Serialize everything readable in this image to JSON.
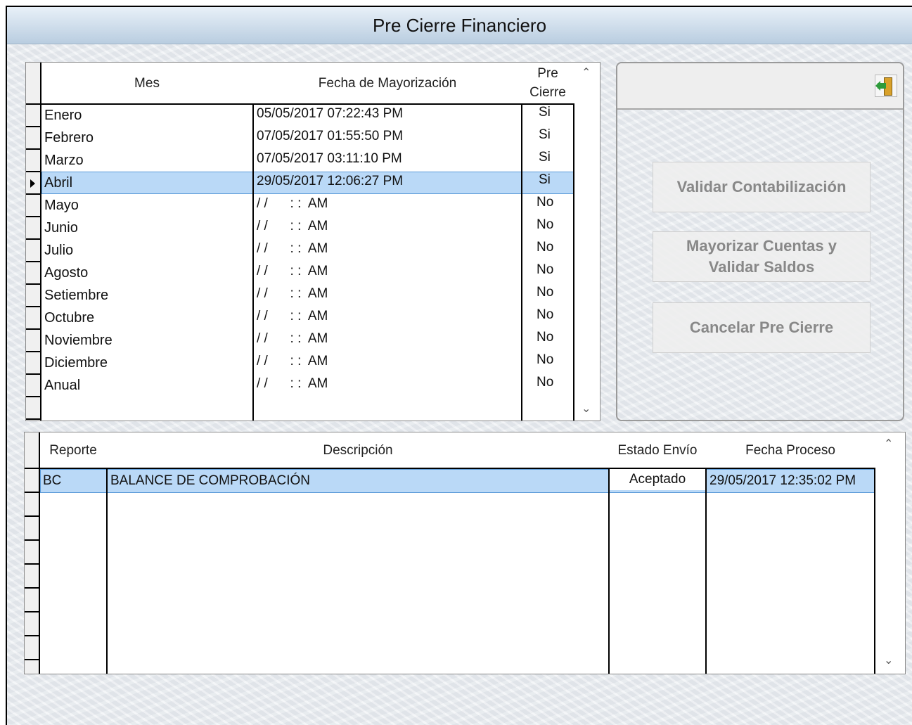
{
  "window": {
    "title": "Pre Cierre Financiero"
  },
  "months_table": {
    "headers": {
      "mes": "Mes",
      "fecha": "Fecha de Mayorización",
      "pre_cierre_1": "Pre",
      "pre_cierre_2": "Cierre"
    },
    "rows": [
      {
        "mes": "Enero",
        "fecha": "05/05/2017 07:22:43 PM",
        "pre": "Si"
      },
      {
        "mes": "Febrero",
        "fecha": "07/05/2017 01:55:50 PM",
        "pre": "Si"
      },
      {
        "mes": "Marzo",
        "fecha": "07/05/2017 03:11:10 PM",
        "pre": "Si"
      },
      {
        "mes": "Abril",
        "fecha": "29/05/2017 12:06:27 PM",
        "pre": "Si"
      },
      {
        "mes": "Mayo",
        "fecha": "/ /      : :  AM",
        "pre": "No"
      },
      {
        "mes": "Junio",
        "fecha": "/ /      : :  AM",
        "pre": "No"
      },
      {
        "mes": "Julio",
        "fecha": "/ /      : :  AM",
        "pre": "No"
      },
      {
        "mes": "Agosto",
        "fecha": "/ /      : :  AM",
        "pre": "No"
      },
      {
        "mes": "Setiembre",
        "fecha": "/ /      : :  AM",
        "pre": "No"
      },
      {
        "mes": "Octubre",
        "fecha": "/ /      : :  AM",
        "pre": "No"
      },
      {
        "mes": "Noviembre",
        "fecha": "/ /      : :  AM",
        "pre": "No"
      },
      {
        "mes": "Diciembre",
        "fecha": "/ /      : :  AM",
        "pre": "No"
      },
      {
        "mes": "Anual",
        "fecha": "/ /      : :  AM",
        "pre": "No"
      }
    ]
  },
  "actions": {
    "validar": "Validar Contabilización",
    "mayorizar_1": "Mayorizar Cuentas y",
    "mayorizar_2": "Validar Saldos",
    "cancelar": "Cancelar Pre Cierre",
    "exit_icon": "exit-door-icon"
  },
  "reports_table": {
    "headers": {
      "reporte": "Reporte",
      "descripcion": "Descripción",
      "estado": "Estado Envío",
      "fecha": "Fecha Proceso"
    },
    "rows": [
      {
        "reporte": "BC",
        "descripcion": "BALANCE DE COMPROBACIÓN",
        "estado": "Aceptado",
        "fecha": "29/05/2017 12:35:02 PM"
      }
    ]
  },
  "colors": {
    "selection": "#bad9f7",
    "title_gradient_top": "#e8f0f8",
    "title_gradient_bottom": "#b9cde0"
  }
}
